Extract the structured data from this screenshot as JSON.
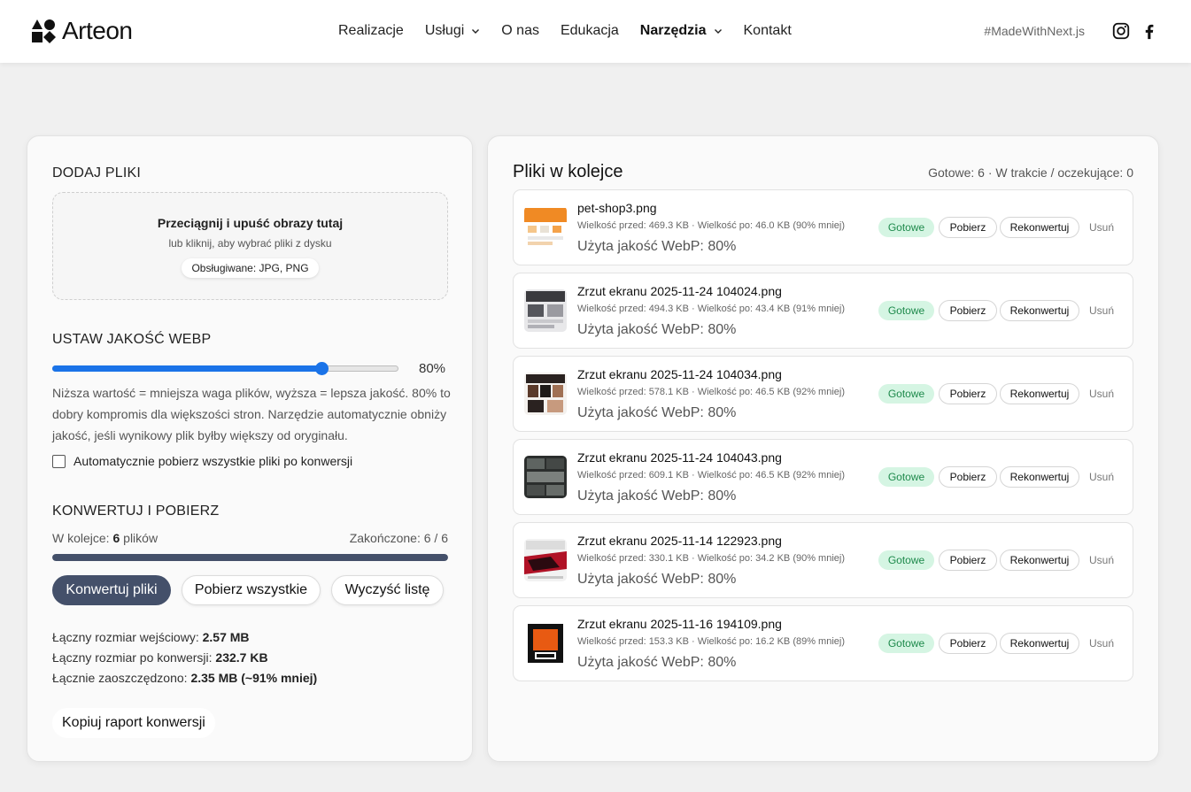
{
  "header": {
    "logo_text": "Arteon",
    "nav": [
      {
        "label": "Realizacje",
        "dropdown": false,
        "active": false
      },
      {
        "label": "Usługi",
        "dropdown": true,
        "active": false
      },
      {
        "label": "O nas",
        "dropdown": false,
        "active": false
      },
      {
        "label": "Edukacja",
        "dropdown": false,
        "active": false
      },
      {
        "label": "Narzędzia",
        "dropdown": true,
        "active": true
      },
      {
        "label": "Kontakt",
        "dropdown": false,
        "active": false
      }
    ],
    "tagline": "#MadeWithNext.js",
    "social_icons": [
      "instagram-icon",
      "facebook-icon"
    ]
  },
  "upload": {
    "title": "DODAJ PLIKI",
    "dropzone_title": "Przeciągnij i upuść obrazy tutaj",
    "dropzone_subtitle": "lub kliknij, aby wybrać pliki z dysku",
    "supported": "Obsługiwane: JPG, PNG"
  },
  "quality": {
    "title": "USTAW JAKOŚĆ WEBP",
    "value": 80,
    "value_label": "80%",
    "help": "Niższa wartość = mniejsza waga plików, wyższa = lepsza jakość. 80% to dobry kompromis dla większości stron. Narzędzie automatycznie obniży jakość, jeśli wynikowy plik byłby większy od oryginału.",
    "auto_download_label": "Automatycznie pobierz wszystkie pliki po konwersji",
    "auto_download_checked": false
  },
  "convert": {
    "title": "KONWERTUJ I POBIERZ",
    "queue_prefix": "W kolejce: ",
    "queue_count": "6",
    "queue_suffix": " plików",
    "finished": "Zakończone: 6 / 6",
    "progress": 1.0,
    "convert_button": "Konwertuj pliki",
    "download_all_button": "Pobierz wszystkie",
    "clear_button": "Wyczyść listę",
    "total_input_label": "Łączny rozmiar wejściowy: ",
    "total_input_value": "2.57 MB",
    "total_output_label": "Łączny rozmiar po konwersji: ",
    "total_output_value": "232.7 KB",
    "saved_label": "Łącznie zaoszczędzono: ",
    "saved_value": "2.35 MB (~91% mniej)",
    "copy_report_button": "Kopiuj raport konwersji"
  },
  "queue": {
    "title": "Pliki w kolejce",
    "status": "Gotowe: 6 · W trakcie / oczekujące: 0",
    "files": [
      {
        "name": "pet-shop3.png",
        "sizes": "Wielkość przed: 469.3 KB · Wielkość po: 46.0 KB (90% mniej)",
        "quality": "Użyta jakość WebP: 80%",
        "status": "Gotowe",
        "download": "Pobierz",
        "reconvert": "Rekonwertuj",
        "remove": "Usuń"
      },
      {
        "name": "Zrzut ekranu 2025-11-24 104024.png",
        "sizes": "Wielkość przed: 494.3 KB · Wielkość po: 43.4 KB (91% mniej)",
        "quality": "Użyta jakość WebP: 80%",
        "status": "Gotowe",
        "download": "Pobierz",
        "reconvert": "Rekonwertuj",
        "remove": "Usuń"
      },
      {
        "name": "Zrzut ekranu 2025-11-24 104034.png",
        "sizes": "Wielkość przed: 578.1 KB · Wielkość po: 46.5 KB (92% mniej)",
        "quality": "Użyta jakość WebP: 80%",
        "status": "Gotowe",
        "download": "Pobierz",
        "reconvert": "Rekonwertuj",
        "remove": "Usuń"
      },
      {
        "name": "Zrzut ekranu 2025-11-24 104043.png",
        "sizes": "Wielkość przed: 609.1 KB · Wielkość po: 46.5 KB (92% mniej)",
        "quality": "Użyta jakość WebP: 80%",
        "status": "Gotowe",
        "download": "Pobierz",
        "reconvert": "Rekonwertuj",
        "remove": "Usuń"
      },
      {
        "name": "Zrzut ekranu 2025-11-14 122923.png",
        "sizes": "Wielkość przed: 330.1 KB · Wielkość po: 34.2 KB (90% mniej)",
        "quality": "Użyta jakość WebP: 80%",
        "status": "Gotowe",
        "download": "Pobierz",
        "reconvert": "Rekonwertuj",
        "remove": "Usuń"
      },
      {
        "name": "Zrzut ekranu 2025-11-16 194109.png",
        "sizes": "Wielkość przed: 153.3 KB · Wielkość po: 16.2 KB (89% mniej)",
        "quality": "Użyta jakość WebP: 80%",
        "status": "Gotowe",
        "download": "Pobierz",
        "reconvert": "Rekonwertuj",
        "remove": "Usuń"
      }
    ]
  },
  "colors": {
    "accent": "#44506a",
    "slider": "#1a73e8",
    "status_bg": "#d5f5e3",
    "status_text": "#1e8a4c"
  }
}
